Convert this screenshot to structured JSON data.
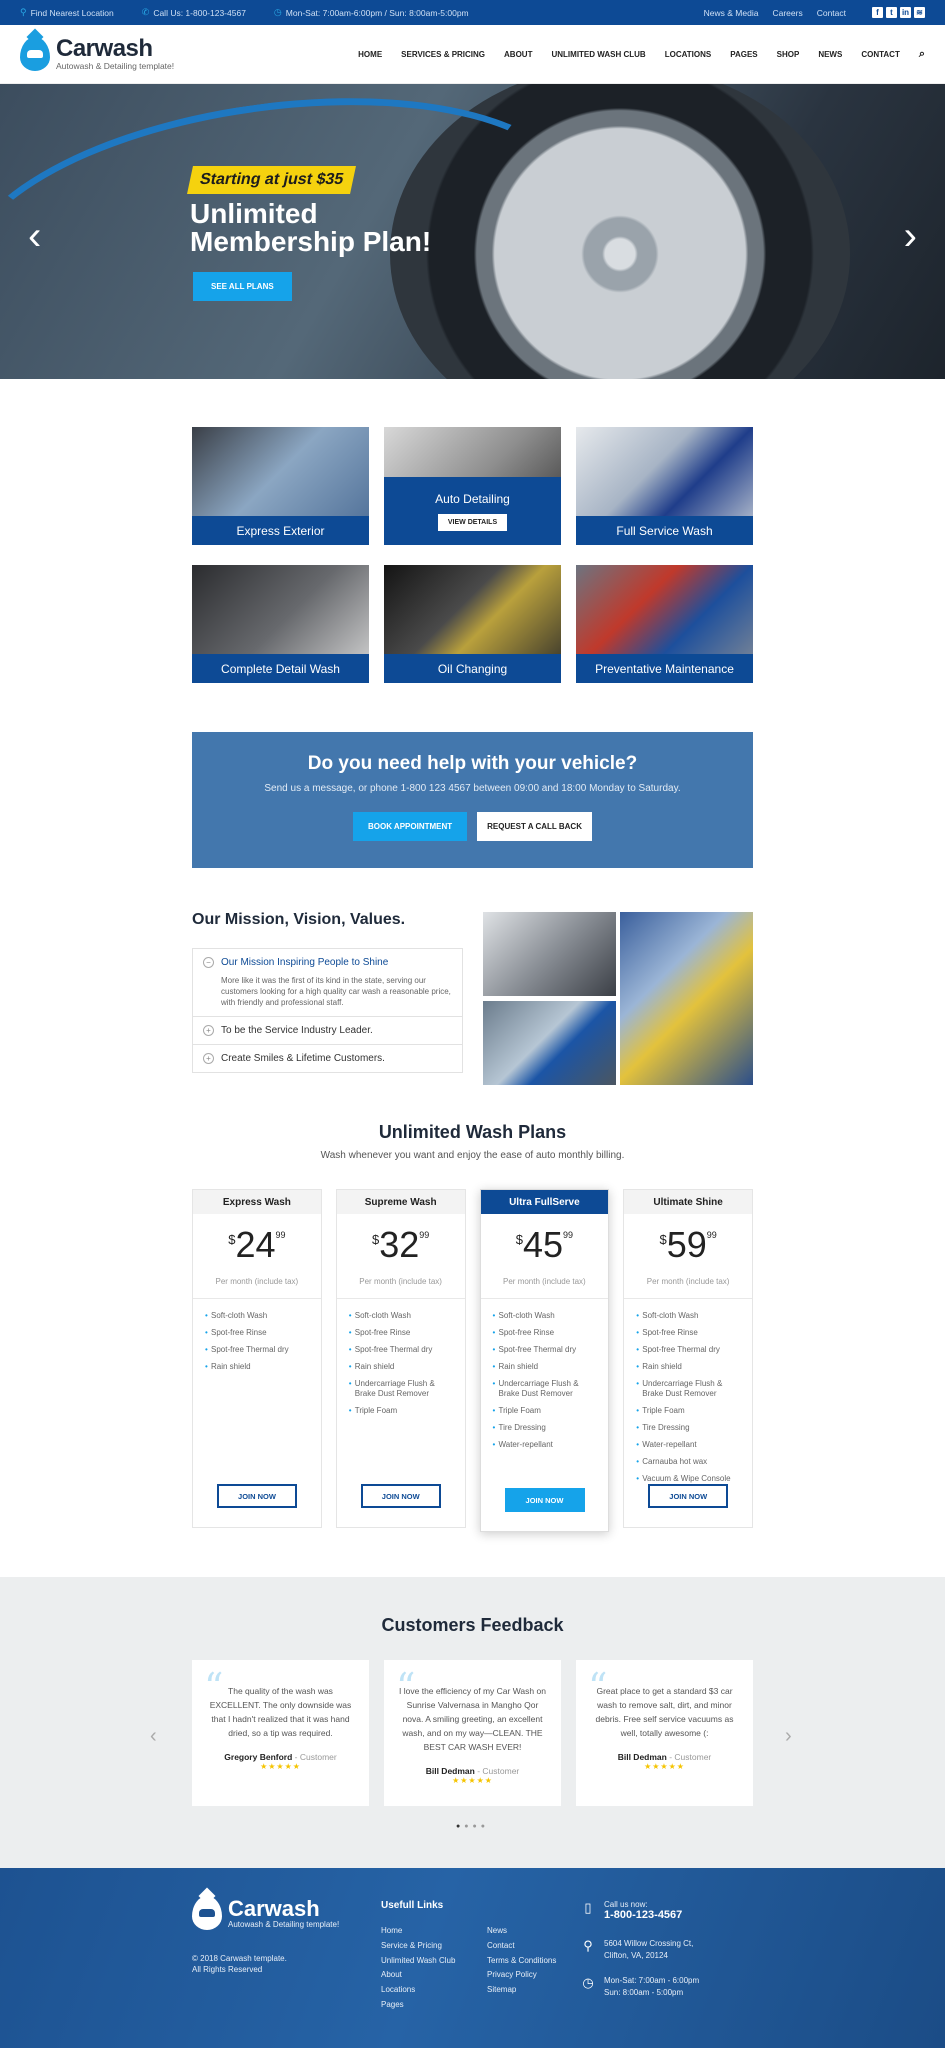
{
  "topbar": {
    "location": "Find Nearest Location",
    "phone": "Call Us: 1-800-123-4567",
    "hours": "Mon-Sat: 7:00am-6:00pm / Sun: 8:00am-5:00pm",
    "links": [
      "News & Media",
      "Careers",
      "Contact"
    ]
  },
  "brand": {
    "name": "Carwash",
    "tagline": "Autowash & Detailing template!",
    "color": "#0d4a95",
    "accent": "#15a3ea"
  },
  "nav": [
    "HOME",
    "SERVICES & PRICING",
    "ABOUT",
    "UNLIMITED WASH CLUB",
    "LOCATIONS",
    "PAGES",
    "SHOP",
    "NEWS",
    "CONTACT"
  ],
  "hero": {
    "badge": "Starting at just $35",
    "title_line1": "Unlimited",
    "title_line2": "Membership Plan!",
    "button": "SEE ALL PLANS"
  },
  "services": [
    {
      "label": "Express Exterior"
    },
    {
      "label": "Auto Detailing",
      "button": "VIEW DETAILS"
    },
    {
      "label": "Full Service Wash"
    },
    {
      "label": "Complete Detail Wash"
    },
    {
      "label": "Oil Changing"
    },
    {
      "label": "Preventative Maintenance"
    }
  ],
  "cta": {
    "title": "Do you need help with your vehicle?",
    "text": "Send us a message, or phone 1-800 123 4567 between 09:00 and 18:00 Monday to Saturday.",
    "btn1": "BOOK APPOINTMENT",
    "btn2": "REQUEST A CALL BACK"
  },
  "mission": {
    "title": "Our Mission, Vision, Values.",
    "items": [
      {
        "title": "Our Mission Inspiring People to Shine",
        "body": "More like it was the first of its kind in the state, serving our customers looking for a high quality car wash a reasonable price, with friendly and professional staff."
      },
      {
        "title": "To be the Service Industry Leader."
      },
      {
        "title": "Create Smiles & Lifetime Customers."
      }
    ]
  },
  "plans": {
    "title": "Unlimited Wash Plans",
    "subtitle": "Wash whenever you want and enjoy the ease of auto monthly billing.",
    "items": [
      {
        "name": "Express Wash",
        "currency": "$",
        "price": "24",
        "cents": "99",
        "per": "Per month (include tax)",
        "features": [
          "Soft-cloth Wash",
          "Spot-free Rinse",
          "Spot-free Thermal dry",
          "Rain shield"
        ],
        "button": "JOIN NOW"
      },
      {
        "name": "Supreme Wash",
        "currency": "$",
        "price": "32",
        "cents": "99",
        "per": "Per month (include tax)",
        "features": [
          "Soft-cloth Wash",
          "Spot-free Rinse",
          "Spot-free Thermal dry",
          "Rain shield",
          "Undercarriage Flush & Brake Dust Remover",
          "Triple Foam"
        ],
        "button": "JOIN NOW"
      },
      {
        "name": "Ultra FullServe",
        "currency": "$",
        "price": "45",
        "cents": "99",
        "per": "Per month (include tax)",
        "features": [
          "Soft-cloth Wash",
          "Spot-free Rinse",
          "Spot-free Thermal dry",
          "Rain shield",
          "Undercarriage Flush & Brake Dust Remover",
          "Triple Foam",
          "Tire Dressing",
          "Water-repellant"
        ],
        "button": "JOIN NOW"
      },
      {
        "name": "Ultimate Shine",
        "currency": "$",
        "price": "59",
        "cents": "99",
        "per": "Per month (include tax)",
        "features": [
          "Soft-cloth Wash",
          "Spot-free Rinse",
          "Spot-free Thermal dry",
          "Rain shield",
          "Undercarriage Flush & Brake Dust Remover",
          "Triple Foam",
          "Tire Dressing",
          "Water-repellant",
          "Carnauba hot wax",
          "Vacuum & Wipe Console"
        ],
        "button": "JOIN NOW"
      }
    ]
  },
  "feedback": {
    "title": "Customers Feedback",
    "items": [
      {
        "text": "The quality of the wash was EXCELLENT. The only downside was that I hadn't realized that it was hand dried, so a tip was required.",
        "author": "Gregory Benford",
        "role": "- Customer",
        "stars": "★★★★★"
      },
      {
        "text": "I love the efficiency of my Car Wash on Sunrise Valvernasa in Mangho Qor nova. A smiling greeting, an excellent wash, and on my way—CLEAN. THE BEST CAR WASH EVER!",
        "author": "Bill Dedman",
        "role": "- Customer",
        "stars": "★★★★★"
      },
      {
        "text": "Great place to get a standard $3 car wash to remove salt, dirt, and minor debris. Free self service vacuums as well, totally awesome (:",
        "author": "Bill Dedman",
        "role": "- Customer",
        "stars": "★★★★★"
      }
    ]
  },
  "footer": {
    "copyright1": "© 2018 Carwash template.",
    "copyright2": "All Rights Reserved",
    "links_title": "Usefull Links",
    "links_col1": [
      "Home",
      "Service & Pricing",
      "Unlimited Wash Club",
      "About",
      "Locations",
      "Pages"
    ],
    "links_col2": [
      "News",
      "Contact",
      "Terms & Conditions",
      "Privacy Policy",
      "Sitemap"
    ],
    "call_label": "Call us now:",
    "call_number": "1-800-123-4567",
    "address1": "5604 Willow Crossing Ct,",
    "address2": "Clifton, VA, 20124",
    "hours1": "Mon-Sat: 7:00am - 6:00pm",
    "hours2": "Sun: 8:00am - 5:00pm"
  }
}
